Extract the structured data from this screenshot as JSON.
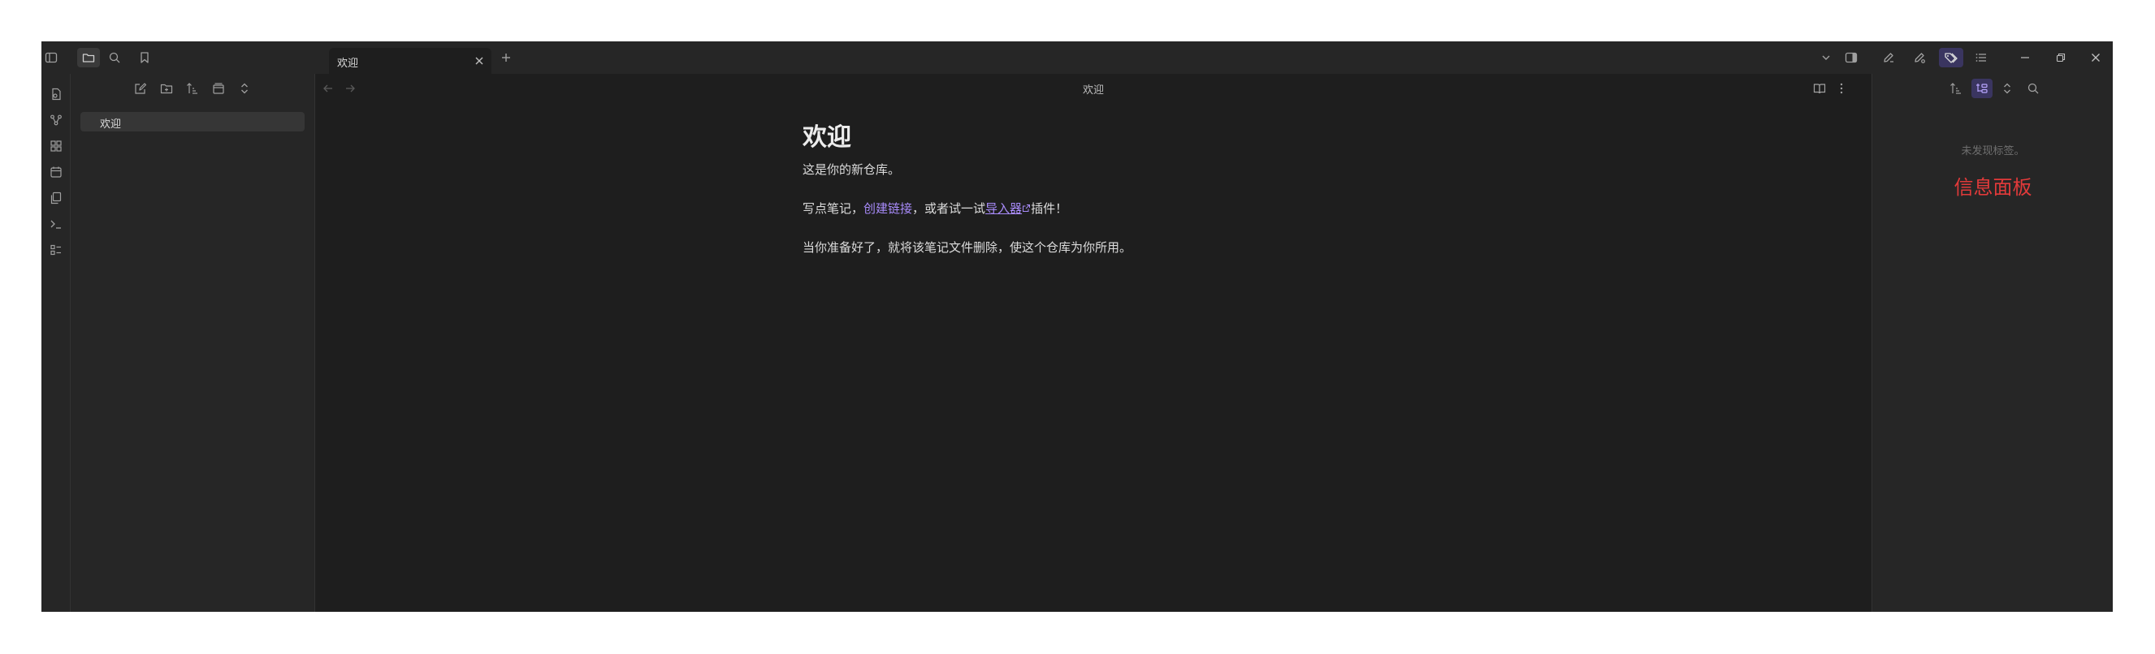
{
  "tab": {
    "title": "欢迎"
  },
  "editor": {
    "view_title": "欢迎",
    "heading": "欢迎",
    "para1": "这是你的新仓库。",
    "para2_before": "写点笔记，",
    "para2_link_internal": "创建链接",
    "para2_middle": "，或者试一试",
    "para2_link_external": "导入器",
    "para2_after": "插件！",
    "para3": "当你准备好了，就将该笔记文件删除，使这个仓库为你所用。"
  },
  "file_explorer": {
    "items": [
      {
        "label": "欢迎",
        "active": true
      }
    ]
  },
  "right_panel": {
    "empty_text": "未发现标签。",
    "info_label": "信息面板"
  },
  "colors": {
    "accent": "#a88bfa",
    "info_red": "#e23a3a",
    "background": "#1e1e1e",
    "panel": "#262626"
  },
  "icons": {
    "titlebar_left": [
      "sidebar-toggle-icon",
      "folder-icon",
      "search-icon",
      "bookmark-icon"
    ],
    "ribbon": [
      "quick-switcher-icon",
      "graph-icon",
      "canvas-icon",
      "calendar-icon",
      "templates-icon",
      "command-palette-icon",
      "outline-icon"
    ],
    "explorer_toolbar": [
      "new-note-icon",
      "new-folder-icon",
      "sort-icon",
      "collapse-icon",
      "expand-icon"
    ],
    "titlebar_right": [
      "tab-list-chevron-icon",
      "right-sidebar-toggle-icon",
      "pen-icon",
      "pen-star-icon",
      "tags-icon",
      "list-icon"
    ],
    "window_controls": [
      "minimize-icon",
      "restore-icon",
      "close-icon"
    ],
    "right_toolbar": [
      "sort-icon",
      "tag-tree-icon",
      "expand-icon",
      "search-icon"
    ]
  }
}
